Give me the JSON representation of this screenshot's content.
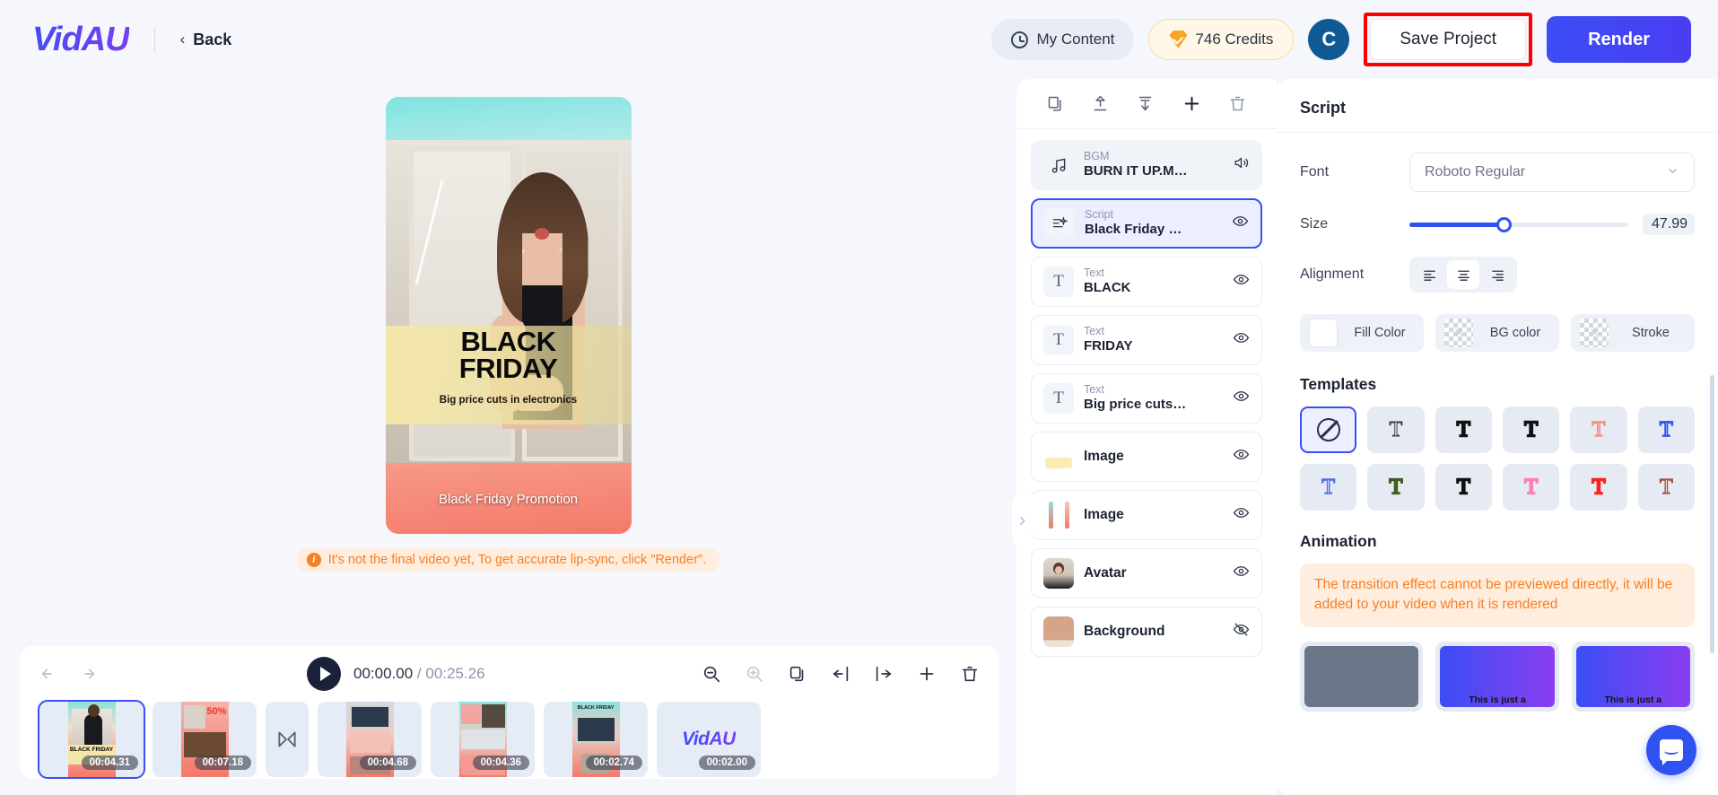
{
  "header": {
    "logo": "VidAU",
    "back_label": "Back",
    "back_chevron": "‹",
    "my_content_label": "My Content",
    "credits_label": "746 Credits",
    "avatar_initial": "C",
    "save_label": "Save Project",
    "render_label": "Render",
    "highlight_color": "#ff0000",
    "accent_color": "#3b4ef5"
  },
  "preview": {
    "title_line1": "BLACK",
    "title_line2": "FRIDAY",
    "subtitle": "Big price cuts in electronics",
    "caption": "Black Friday Promotion",
    "notice_icon": "i",
    "notice": "It's not the final video yet, To get accurate lip-sync, click \"Render\"."
  },
  "timeline": {
    "undo_icon": "undo-icon",
    "redo_icon": "redo-icon",
    "current_time": "00:00.00",
    "separator": "/",
    "total_time": "00:25.26",
    "tools": [
      "zoom-out-icon",
      "zoom-in-icon",
      "duplicate-icon",
      "split-left-icon",
      "split-right-icon",
      "add-icon",
      "delete-icon"
    ],
    "clips": [
      {
        "duration": "00:04.31",
        "kind": "video",
        "selected": true
      },
      {
        "duration": "00:07.18",
        "kind": "video",
        "selected": false
      },
      {
        "duration": "",
        "kind": "transition",
        "selected": false
      },
      {
        "duration": "00:04.68",
        "kind": "video",
        "selected": false
      },
      {
        "duration": "00:04.36",
        "kind": "video",
        "selected": false
      },
      {
        "duration": "00:02.74",
        "kind": "video",
        "selected": false
      },
      {
        "duration": "00:02.00",
        "kind": "logo",
        "selected": false,
        "logo_text": "VidAU"
      }
    ]
  },
  "layers": {
    "toolbar_icons": [
      "copy-icon",
      "move-to-front-icon",
      "move-to-back-icon",
      "add-icon",
      "delete-icon"
    ],
    "items": [
      {
        "kind": "BGM",
        "name": "BURN IT UP.M…",
        "icon": "music-note-icon",
        "eye": "speaker-icon",
        "state": "bgm"
      },
      {
        "kind": "Script",
        "name": "Black Friday …",
        "icon": "script-icon",
        "eye": "eye-icon",
        "state": "active"
      },
      {
        "kind": "Text",
        "name": "BLACK",
        "icon": "text-t-icon",
        "eye": "eye-icon",
        "state": ""
      },
      {
        "kind": "Text",
        "name": "FRIDAY",
        "icon": "text-t-icon",
        "eye": "eye-icon",
        "state": ""
      },
      {
        "kind": "Text",
        "name": "Big price cuts…",
        "icon": "text-t-icon",
        "eye": "eye-icon",
        "state": ""
      },
      {
        "kind": "",
        "name": "Image",
        "icon": "image-thumb",
        "eye": "eye-icon",
        "state": ""
      },
      {
        "kind": "",
        "name": "Image",
        "icon": "image-thumb-2",
        "eye": "eye-icon",
        "state": ""
      },
      {
        "kind": "",
        "name": "Avatar",
        "icon": "avatar-thumb",
        "eye": "eye-icon",
        "state": ""
      },
      {
        "kind": "",
        "name": "Background",
        "icon": "background-thumb",
        "eye": "eye-off-icon",
        "state": ""
      }
    ]
  },
  "script_panel": {
    "title": "Script",
    "font_label": "Font",
    "font_value": "Roboto Regular",
    "size_label": "Size",
    "size_value": "47.99",
    "size_percent": 43,
    "alignment_label": "Alignment",
    "alignment_options": [
      "align-left",
      "align-center",
      "align-right"
    ],
    "alignment_selected": 1,
    "fill_color_label": "Fill Color",
    "bg_color_label": "BG color",
    "stroke_label": "Stroke",
    "templates_title": "Templates",
    "templates": [
      {
        "glyph": "none",
        "color": "",
        "selected": true
      },
      {
        "glyph": "T",
        "color": "#ffffff",
        "selected": false
      },
      {
        "glyph": "T",
        "color": "#ffffff",
        "selected": false
      },
      {
        "glyph": "T",
        "color": "#ffd400",
        "selected": false
      },
      {
        "glyph": "T",
        "color": "#fa8b80",
        "selected": false
      },
      {
        "glyph": "T",
        "color": "#2f52f0",
        "selected": false
      },
      {
        "glyph": "T",
        "color": "#4a6cf7",
        "selected": false
      },
      {
        "glyph": "T",
        "color": "#4f7a2a",
        "selected": false
      },
      {
        "glyph": "T",
        "color": "#b9d9ea",
        "selected": false
      },
      {
        "glyph": "T",
        "color": "#ff7fb0",
        "selected": false
      },
      {
        "glyph": "T",
        "color": "#ff2020",
        "selected": false
      },
      {
        "glyph": "T",
        "color": "#a04a3a",
        "selected": false
      }
    ],
    "animation_title": "Animation",
    "animation_warning": "The transition effect cannot be previewed directly, it will be added to your video when it is rendered",
    "animation_cards": [
      {
        "style": "grey",
        "text": ""
      },
      {
        "style": "blue",
        "text": "This is just a"
      },
      {
        "style": "blue",
        "text": "This is just a"
      }
    ]
  },
  "collapse_handle": {
    "icon": "chevron-right-icon"
  },
  "chat": {
    "icon": "chat-bubble-icon"
  }
}
